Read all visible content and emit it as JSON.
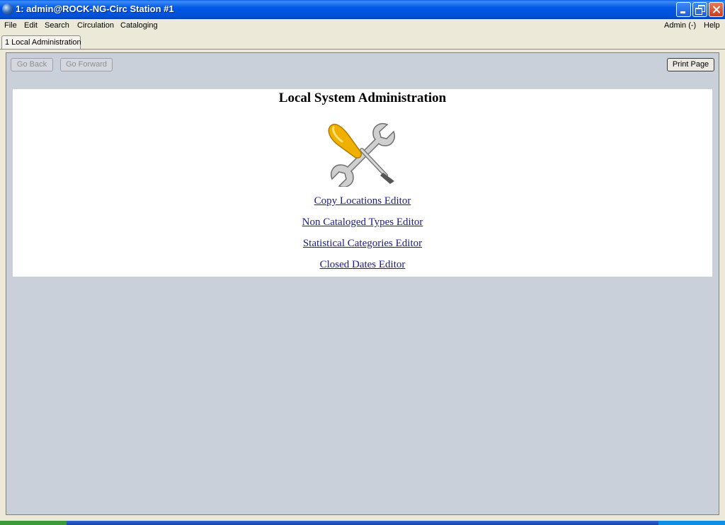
{
  "window": {
    "title": "1: admin@ROCK-NG-Circ Station #1"
  },
  "menubar": {
    "items": [
      "File",
      "Edit",
      "Search",
      "Circulation",
      "Cataloging"
    ],
    "right_items": [
      "Admin (-)",
      "Help"
    ]
  },
  "tabs": [
    {
      "label": "1 Local Administration",
      "active": true
    }
  ],
  "toolbar": {
    "go_back_label": "Go Back",
    "go_forward_label": "Go Forward",
    "print_page_label": "Print Page"
  },
  "page": {
    "title": "Local System Administration",
    "icon": "tools-icon",
    "links": [
      "Copy Locations Editor",
      "Non Cataloged Types Editor",
      "Statistical Categories Editor",
      "Closed Dates Editor"
    ]
  },
  "colors": {
    "titlebar": "#0054e3",
    "content_background": "#c9d0d9",
    "link": "#1a1a8c"
  }
}
